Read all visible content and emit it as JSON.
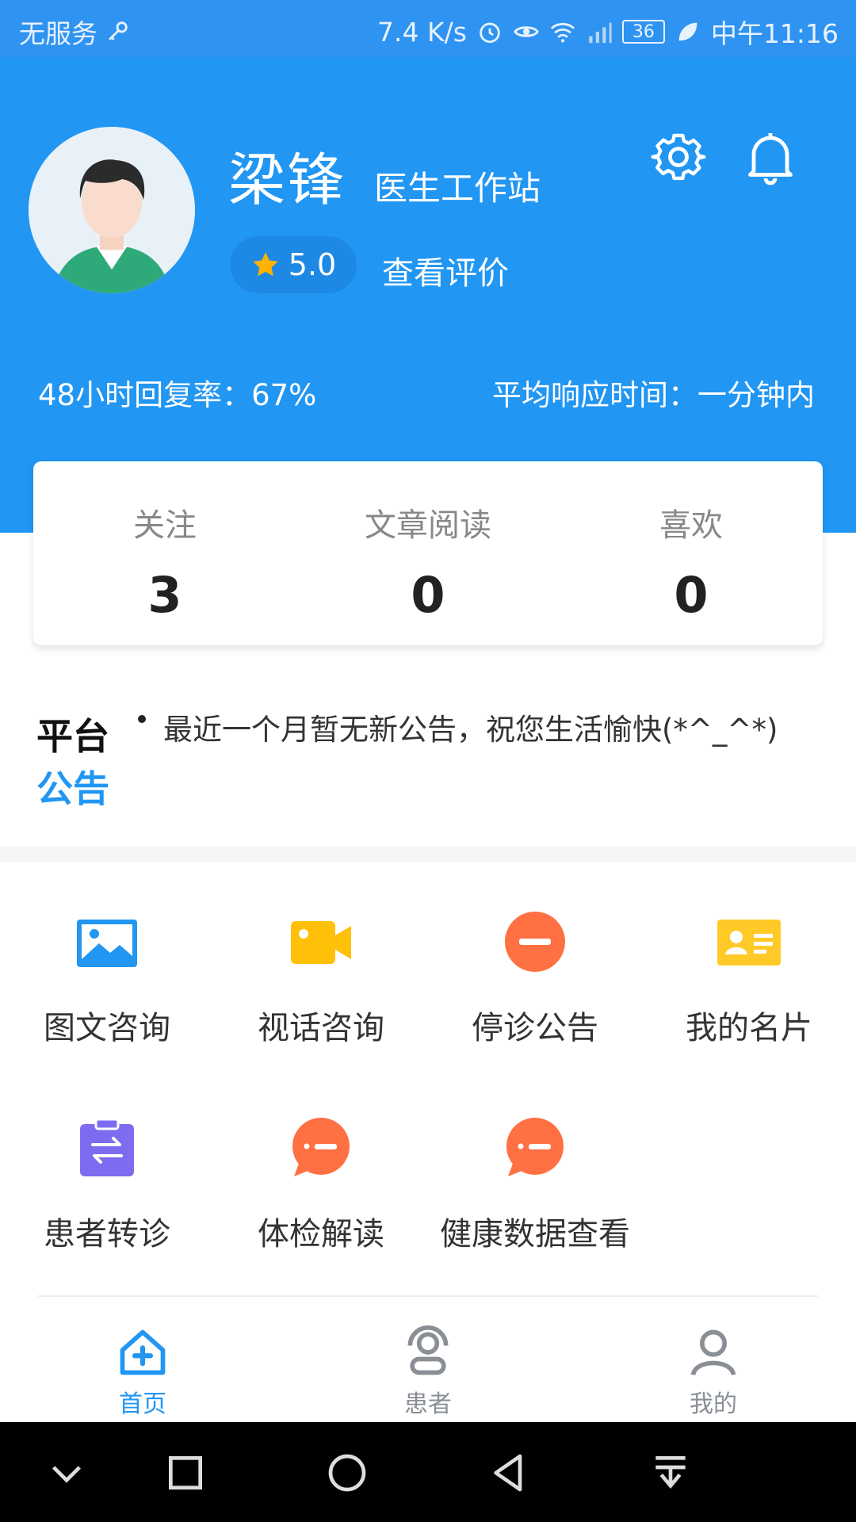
{
  "status_bar": {
    "carrier": "无服务",
    "net_speed": "7.4 K/s",
    "battery": "36",
    "time": "中午11:16"
  },
  "profile": {
    "name": "梁锋",
    "role": "医生工作站",
    "rating": "5.0",
    "view_reviews": "查看评价",
    "reply_rate": "48小时回复率：67%",
    "response_time": "平均响应时间：一分钟内"
  },
  "stats": [
    {
      "label": "关注",
      "value": "3"
    },
    {
      "label": "文章阅读",
      "value": "0"
    },
    {
      "label": "喜欢",
      "value": "0"
    }
  ],
  "notice": {
    "logo_line1": "平台",
    "logo_line2": "公告",
    "text": "最近一个月暂无新公告，祝您生活愉快(*^_^*)"
  },
  "functions": [
    {
      "label": "图文咨询",
      "icon": "image-icon",
      "color": "#2196F3"
    },
    {
      "label": "视话咨询",
      "icon": "video-icon",
      "color": "#FFC107"
    },
    {
      "label": "停诊公告",
      "icon": "stop-icon",
      "color": "#FF7043"
    },
    {
      "label": "我的名片",
      "icon": "card-icon",
      "color": "#FFCA28"
    },
    {
      "label": "患者转诊",
      "icon": "transfer-icon",
      "color": "#7E6CF0"
    },
    {
      "label": "体检解读",
      "icon": "chat-icon",
      "color": "#FF7043"
    },
    {
      "label": "健康数据查看",
      "icon": "chat-icon",
      "color": "#FF7043"
    }
  ],
  "tabs": [
    {
      "label": "首页",
      "active": true
    },
    {
      "label": "患者",
      "active": false
    },
    {
      "label": "我的",
      "active": false
    }
  ],
  "colors": {
    "primary": "#2196F3",
    "inactive": "#8a8f96"
  }
}
